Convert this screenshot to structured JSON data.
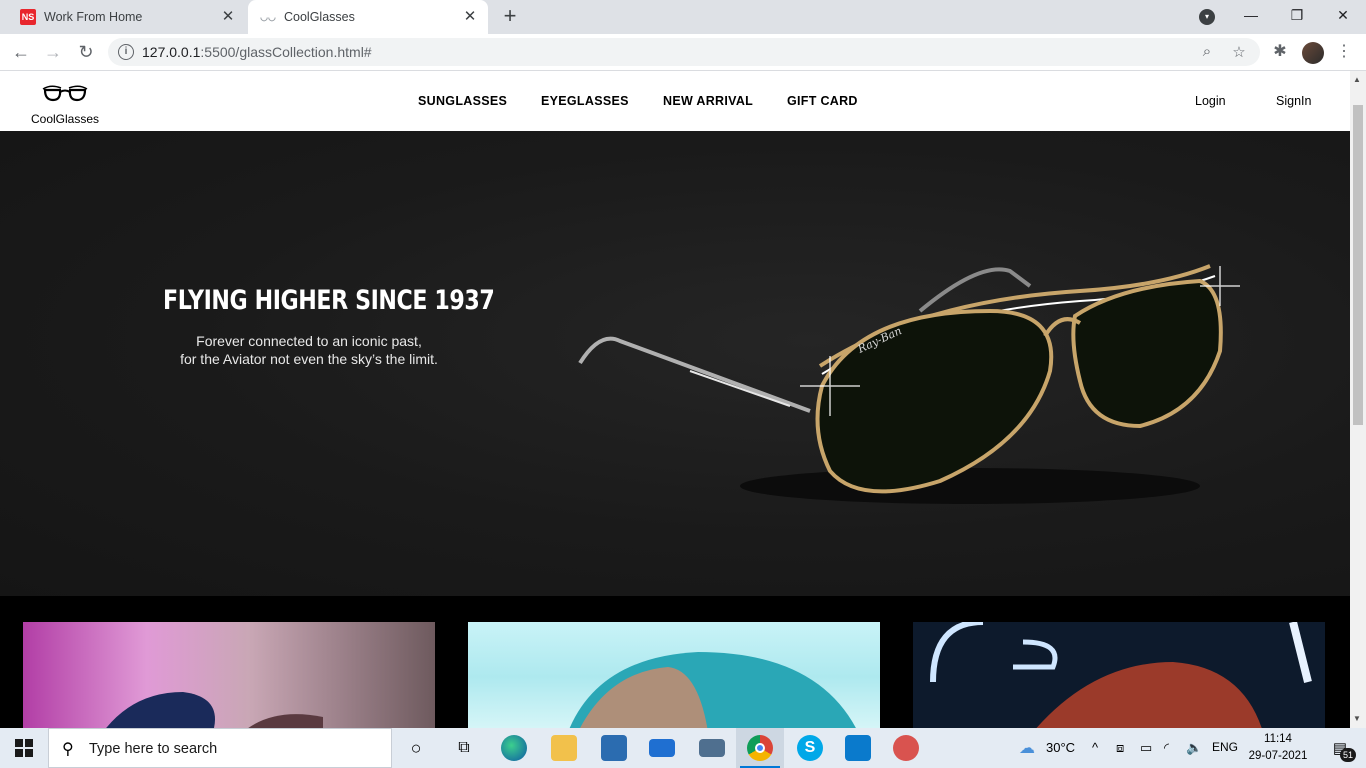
{
  "browser": {
    "tabs": [
      {
        "title": "Work From Home",
        "favicon_text": "NS"
      },
      {
        "title": "CoolGlasses",
        "favicon_text": "◡◡"
      }
    ],
    "url_host": "127.0.0.1",
    "url_rest": ":5500/glassCollection.html#"
  },
  "site": {
    "logo_text": "CoolGlasses",
    "menu": [
      "SUNGLASSES",
      "EYEGLASSES",
      "NEW ARRIVAL",
      "GIFT CARD"
    ],
    "login": "Login",
    "signin": "SignIn"
  },
  "hero": {
    "title": "FLYING HIGHER SINCE 1937",
    "subtitle_line1": "Forever connected to an iconic past,",
    "subtitle_line2": "for the Aviator not even the sky’s the limit.",
    "brand_script": "Ray-Ban"
  },
  "taskbar": {
    "search_placeholder": "Type here to search",
    "weather": "30°C",
    "language": "ENG",
    "time": "11:14",
    "date": "29-07-2021",
    "notification_count": "51"
  },
  "colors": {
    "tabstrip": "#dee1e6",
    "hero_bg": "#1a1a1a",
    "taskbar": "#e4ebf3",
    "accent": "#0078d7"
  }
}
